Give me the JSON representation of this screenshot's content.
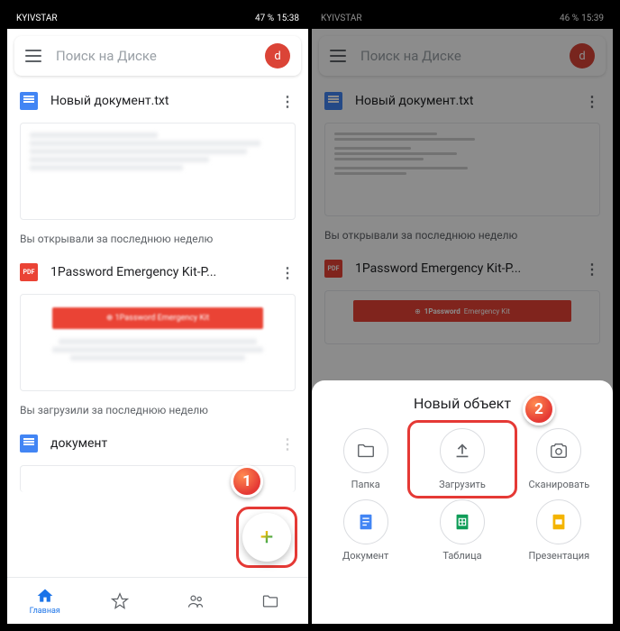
{
  "status": {
    "carrier": "KYIVSTAR",
    "left_battery": "47 %",
    "left_time": "15:38",
    "right_battery": "46 %",
    "right_time": "15:39"
  },
  "search": {
    "placeholder": "Поиск на Диске",
    "avatar_letter": "d"
  },
  "files": {
    "doc1_name": "Новый документ.txt",
    "pdf_name": "1Password Emergency Kit-P...",
    "doc2_name": "документ",
    "pdf_label": "PDF",
    "pdf_brand": "1Password",
    "pdf_tagline": "Emergency Kit"
  },
  "sections": {
    "opened_week": "Вы открывали за последнюю неделю",
    "uploaded_week": "Вы загрузили за последнюю неделю"
  },
  "nav": {
    "home": "Главная"
  },
  "sheet": {
    "title": "Новый объект",
    "folder": "Папка",
    "upload": "Загрузить",
    "scan": "Сканировать",
    "doc": "Документ",
    "sheet": "Таблица",
    "slides": "Презентация"
  },
  "callouts": {
    "one": "1",
    "two": "2"
  }
}
